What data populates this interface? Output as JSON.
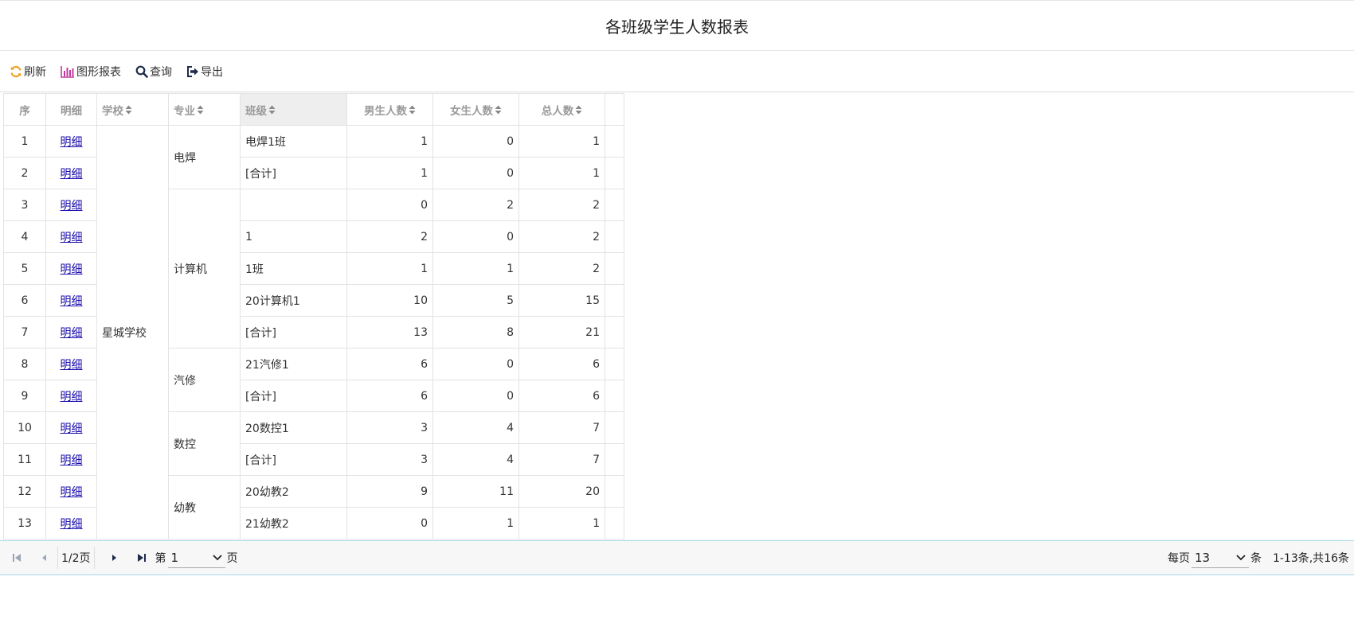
{
  "report": {
    "title": "各班级学生人数报表"
  },
  "toolbar": {
    "refresh": "刷新",
    "chart": "图形报表",
    "query": "查询",
    "export": "导出"
  },
  "colors": {
    "refresh_icon": "#f0a020",
    "chart_icon": "#c0399a",
    "text": "#333333",
    "link": "#1a0dab"
  },
  "table": {
    "headers": {
      "seq": "序",
      "detail": "明细",
      "school": "学校",
      "major": "专业",
      "class": "班级",
      "male": "男生人数",
      "female": "女生人数",
      "total": "总人数"
    },
    "school": "星城学校",
    "majors": [
      "电焊",
      "计算机",
      "汽修",
      "数控",
      "幼教"
    ],
    "rows": [
      {
        "seq": "1",
        "detail": "明细",
        "class": "电焊1班",
        "male": "1",
        "female": "0",
        "total": "1"
      },
      {
        "seq": "2",
        "detail": "明细",
        "class": "[合计]",
        "male": "1",
        "female": "0",
        "total": "1"
      },
      {
        "seq": "3",
        "detail": "明细",
        "class": "",
        "male": "0",
        "female": "2",
        "total": "2"
      },
      {
        "seq": "4",
        "detail": "明细",
        "class": "1",
        "male": "2",
        "female": "0",
        "total": "2"
      },
      {
        "seq": "5",
        "detail": "明细",
        "class": "1班",
        "male": "1",
        "female": "1",
        "total": "2"
      },
      {
        "seq": "6",
        "detail": "明细",
        "class": "20计算机1",
        "male": "10",
        "female": "5",
        "total": "15"
      },
      {
        "seq": "7",
        "detail": "明细",
        "class": "[合计]",
        "male": "13",
        "female": "8",
        "total": "21"
      },
      {
        "seq": "8",
        "detail": "明细",
        "class": "21汽修1",
        "male": "6",
        "female": "0",
        "total": "6"
      },
      {
        "seq": "9",
        "detail": "明细",
        "class": "[合计]",
        "male": "6",
        "female": "0",
        "total": "6"
      },
      {
        "seq": "10",
        "detail": "明细",
        "class": "20数控1",
        "male": "3",
        "female": "4",
        "total": "7"
      },
      {
        "seq": "11",
        "detail": "明细",
        "class": "[合计]",
        "male": "3",
        "female": "4",
        "total": "7"
      },
      {
        "seq": "12",
        "detail": "明细",
        "class": "20幼教2",
        "male": "9",
        "female": "11",
        "total": "20"
      },
      {
        "seq": "13",
        "detail": "明细",
        "class": "21幼教2",
        "male": "0",
        "female": "1",
        "total": "1"
      }
    ]
  },
  "pager": {
    "page_info": "1/2页",
    "goto_prefix": "第",
    "goto_value": "1",
    "goto_suffix": "页",
    "per_page_prefix": "每页",
    "per_page_value": "13",
    "per_page_suffix": "条",
    "range_info": "1-13条,共16条"
  }
}
